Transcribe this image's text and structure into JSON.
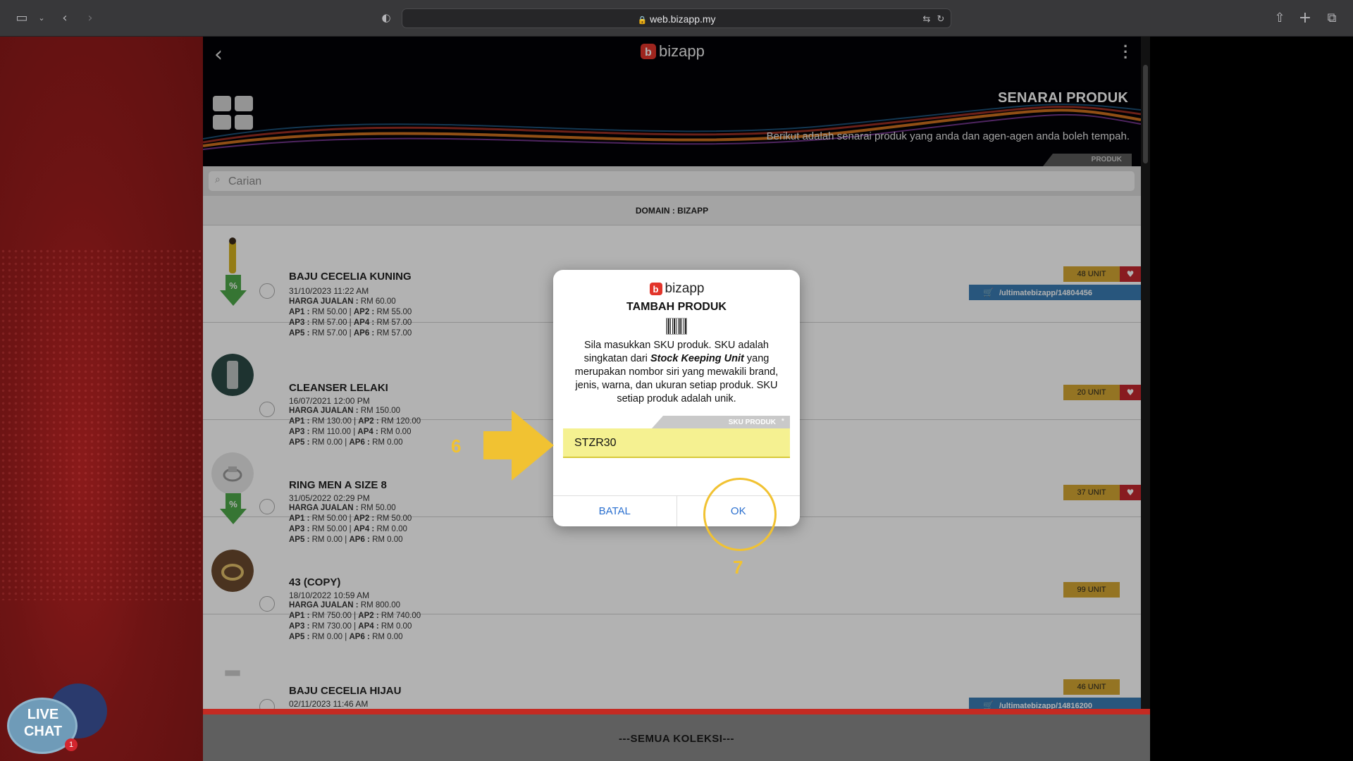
{
  "browser": {
    "url": "web.bizapp.my"
  },
  "header": {
    "brand": "bizapp",
    "page_title": "SENARAI PRODUK",
    "subtitle": "Berikut adalah senarai produk yang anda dan agen-agen anda boleh tempah.",
    "tab": "PRODUK"
  },
  "search": {
    "placeholder": "Carian"
  },
  "domain": "DOMAIN : BIZAPP",
  "products": [
    {
      "name": "BAJU CECELIA KUNING",
      "date": "31/10/2023 11:22 AM",
      "harga": "RM 60.00",
      "ap1": "RM 50.00",
      "ap2": "RM 55.00",
      "ap3": "RM 57.00",
      "ap4": "RM 57.00",
      "ap5": "RM 57.00",
      "ap6": "RM 57.00",
      "units": "48 UNIT",
      "link": "/ultimatebizapp/14804456"
    },
    {
      "name": "CLEANSER LELAKI",
      "date": "16/07/2021 12:00 PM",
      "harga": "RM 150.00",
      "ap1": "RM 130.00",
      "ap2": "RM 120.00",
      "ap3": "RM 110.00",
      "ap4": "RM 0.00",
      "ap5": "RM 0.00",
      "ap6": "RM 0.00",
      "units": "20 UNIT"
    },
    {
      "name": "RING MEN A SIZE 8",
      "date": "31/05/2022 02:29 PM",
      "harga": "RM 50.00",
      "ap1": "RM 50.00",
      "ap2": "RM 50.00",
      "ap3": "RM 50.00",
      "ap4": "RM 0.00",
      "ap5": "RM 0.00",
      "ap6": "RM 0.00",
      "units": "37 UNIT"
    },
    {
      "name": "43 (COPY)",
      "date": "18/10/2022 10:59 AM",
      "harga": "RM 800.00",
      "ap1": "RM 750.00",
      "ap2": "RM 740.00",
      "ap3": "RM 730.00",
      "ap4": "RM 0.00",
      "ap5": "RM 0.00",
      "ap6": "RM 0.00",
      "units": "99 UNIT"
    },
    {
      "name": "BAJU CECELIA HIJAU",
      "date": "02/11/2023 11:46 AM",
      "units": "46 UNIT",
      "link": "/ultimatebizapp/14816200"
    }
  ],
  "labels": {
    "harga": "HARGA JUALAN :",
    "ap1": "AP1 :",
    "ap2": "AP2 :",
    "ap3": "AP3 :",
    "ap4": "AP4 :",
    "ap5": "AP5 :",
    "ap6": "AP6 :"
  },
  "bottom_bar": "---SEMUA KOLEKSI---",
  "modal": {
    "brand": "bizapp",
    "title": "TAMBAH PRODUK",
    "desc_pre": "Sila masukkan SKU produk. SKU adalah singkatan dari ",
    "desc_em": "Stock Keeping Unit",
    "desc_post": " yang merupakan nombor siri yang mewakili brand, jenis, warna, dan ukuran setiap produk. SKU setiap produk adalah unik.",
    "field_label": "SKU PRODUK",
    "field_required": "*",
    "field_value": "STZR30",
    "cancel": "BATAL",
    "ok": "OK"
  },
  "annotations": {
    "step6": "6",
    "step7": "7"
  },
  "livechat": {
    "line1": "LIVE",
    "line2": "CHAT",
    "badge": "1"
  },
  "colors": {
    "accent_red": "#c3282e",
    "badge_gold": "#d4a633",
    "link_blue": "#3a7cb3",
    "annotation_yellow": "#f1c232",
    "field_yellow": "#f5f191"
  }
}
